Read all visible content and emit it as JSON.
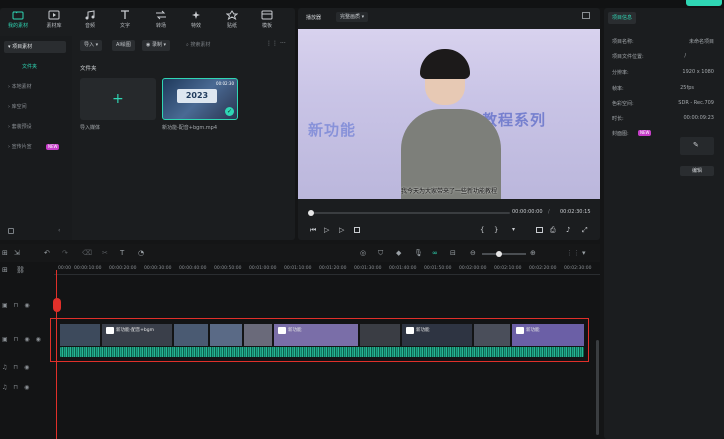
{
  "toolbar": {
    "items": [
      {
        "label": "我的素材",
        "icon": "folder-icon"
      },
      {
        "label": "素材库",
        "icon": "media-icon"
      },
      {
        "label": "音频",
        "icon": "music-icon"
      },
      {
        "label": "文字",
        "icon": "text-icon"
      },
      {
        "label": "转场",
        "icon": "transition-icon"
      },
      {
        "label": "特效",
        "icon": "effects-icon"
      },
      {
        "label": "贴纸",
        "icon": "sticker-icon"
      },
      {
        "label": "模板",
        "icon": "template-icon"
      }
    ]
  },
  "sidebar": {
    "items": [
      "项目素材",
      "文件夹",
      "本地素材",
      "库空间",
      "套装预设",
      "宣传片宣"
    ],
    "badge": "NEW"
  },
  "media": {
    "import_label": "导入",
    "ai_label": "AI绘图",
    "record_label": "录制",
    "search_placeholder": "搜索素材",
    "folder_heading": "文件夹",
    "import_tile_label": "导入媒体",
    "clip_name": "新功能-配音+bgm.mp4",
    "clip_duration": "00:02:30",
    "clip_year": "2023"
  },
  "player": {
    "tab": "播放器",
    "quality": "完整画质",
    "subtitle": "我今天为大家带来了一些新功能教程",
    "overlay_left": "新功能",
    "overlay_right": "教程系列",
    "current_time": "00:00:00:00",
    "total_time": "00:02:30:15"
  },
  "properties": {
    "tab": "项目信息",
    "rows": [
      {
        "k": "项目名称:",
        "v": "未命名项目"
      },
      {
        "k": "项目文件位置:",
        "v": "/"
      },
      {
        "k": "分辨率:",
        "v": "1920 x 1080"
      },
      {
        "k": "帧率:",
        "v": "25fps"
      },
      {
        "k": "色彩空间:",
        "v": "SDR - Rec.709"
      },
      {
        "k": "时长:",
        "v": "00:00:09:23"
      },
      {
        "k": "封面图:",
        "v": ""
      }
    ],
    "cover_badge": "NEW",
    "edit_label": "编辑"
  },
  "timeline": {
    "timecodes": [
      "00:00",
      "00:00:10:00",
      "00:00:20:00",
      "00:00:30:00",
      "00:00:40:00",
      "00:00:50:00",
      "00:01:00:00",
      "00:01:10:00",
      "00:01:20:00",
      "00:01:30:00",
      "00:01:40:00",
      "00:01:50:00",
      "00:02:00:00",
      "00:02:10:00",
      "00:02:20:00",
      "00:02:30:00"
    ],
    "clip_label_1": "新功能-配音+bgm",
    "clip_label_2": "新功能",
    "clip_label_3": "新功能",
    "clip_label_4": "新功能"
  },
  "colors": {
    "accent": "#2fd6b4",
    "highlight": "#e0302a",
    "audio": "#1fa588"
  }
}
